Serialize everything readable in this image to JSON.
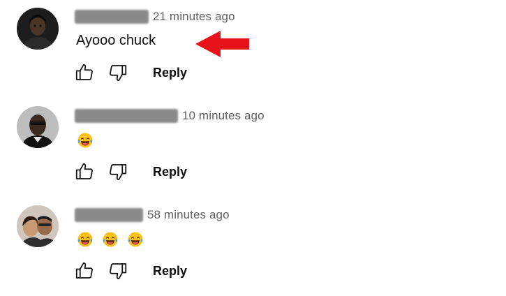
{
  "comments": [
    {
      "time": "21 minutes ago",
      "text": "Ayooo chuck",
      "emojis": [],
      "reply_label": "Reply",
      "like_icon": "thumbs-up-icon",
      "dislike_icon": "thumbs-down-icon"
    },
    {
      "time": "10 minutes ago",
      "text": "",
      "emojis": [
        "face-with-tears-of-joy"
      ],
      "reply_label": "Reply",
      "like_icon": "thumbs-up-icon",
      "dislike_icon": "thumbs-down-icon"
    },
    {
      "time": "58 minutes ago",
      "text": "",
      "emojis": [
        "face-with-tears-of-joy",
        "face-with-tears-of-joy",
        "face-with-tears-of-joy"
      ],
      "reply_label": "Reply",
      "like_icon": "thumbs-up-icon",
      "dislike_icon": "thumbs-down-icon"
    }
  ],
  "annotation": {
    "icon": "red-arrow-icon",
    "color": "#e8121b"
  },
  "colors": {
    "text_primary": "#0f0f0f",
    "text_secondary": "#606060",
    "redaction": "#8a8a8a"
  }
}
